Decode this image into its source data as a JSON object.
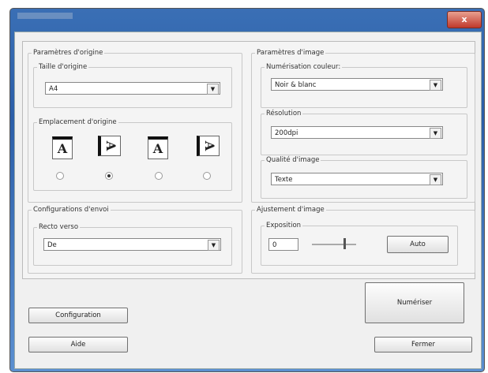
{
  "window": {
    "close_label": "x"
  },
  "origin": {
    "title": "Paramètres d'origine",
    "size_label": "Taille d'origine",
    "size_value": "A4",
    "placement_label": "Emplacement d'origine",
    "selected_placement": 2
  },
  "send": {
    "title": "Configurations d'envoi",
    "duplex_label": "Recto verso",
    "duplex_value": "De"
  },
  "image": {
    "title": "Paramètres d'image",
    "color_label": "Numérisation couleur:",
    "color_value": "Noir & blanc",
    "resolution_label": "Résolution",
    "resolution_value": "200dpi",
    "quality_label": "Qualité d'image",
    "quality_value": "Texte"
  },
  "adjust": {
    "title": "Ajustement d'image",
    "exposure_label": "Exposition",
    "exposure_value": "0",
    "auto_label": "Auto"
  },
  "buttons": {
    "scan": "Numériser",
    "config": "Configuration",
    "help": "Aide",
    "close": "Fermer"
  }
}
